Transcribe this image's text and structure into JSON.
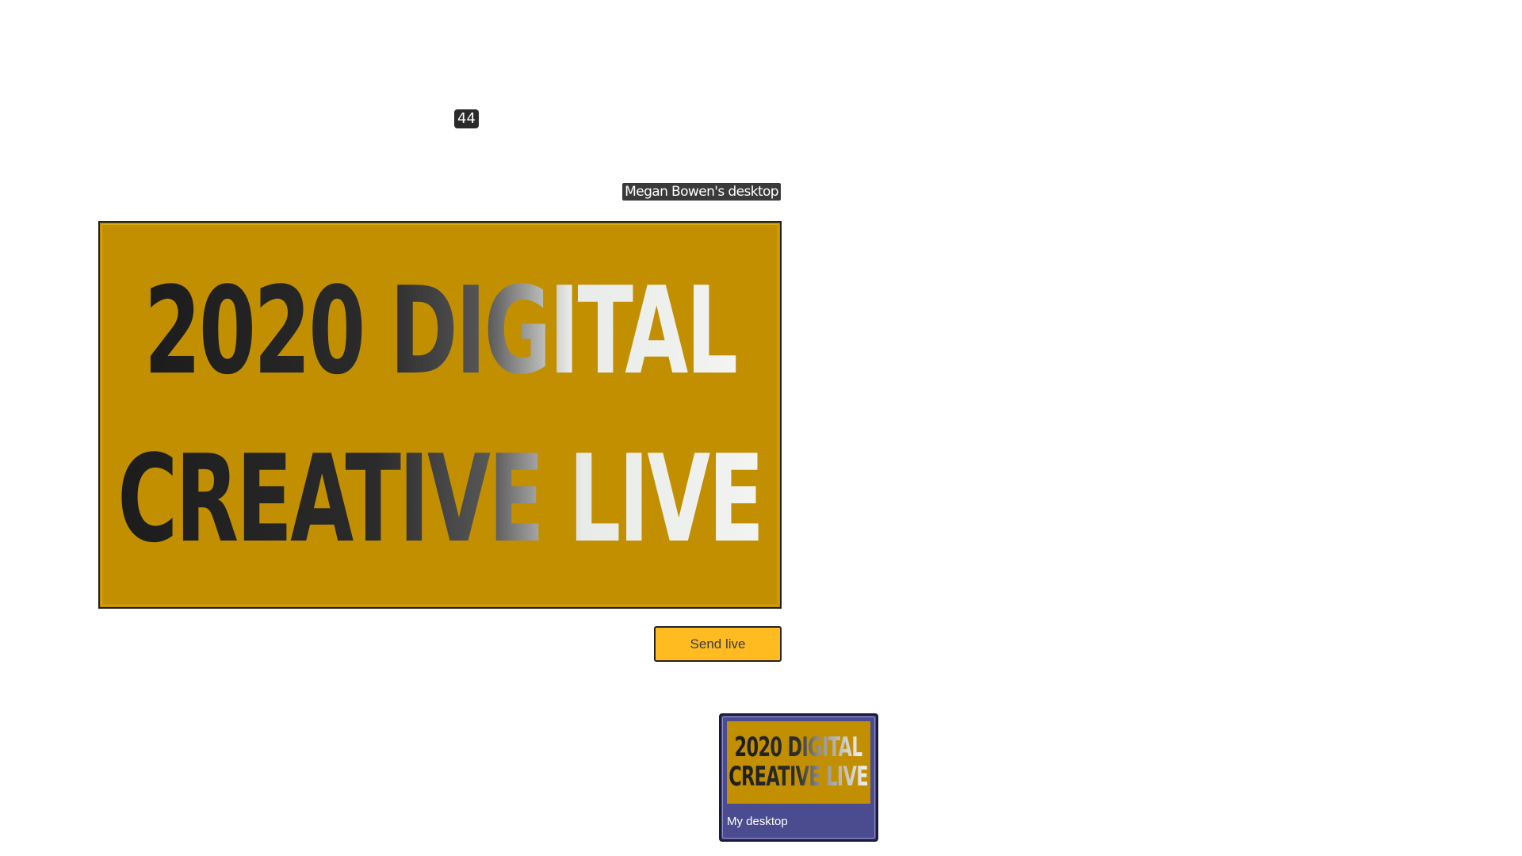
{
  "counter": {
    "value": "44"
  },
  "preview": {
    "label": "Megan Bowen's desktop",
    "content": {
      "line1": "2020 DIGITAL",
      "line2": "CREATIVE LIVE"
    },
    "background_color": "#c18f00"
  },
  "actions": {
    "send_live_label": "Send live",
    "accent_color": "#ffbb1f"
  },
  "sources": [
    {
      "label": "My desktop",
      "thumbnail": {
        "line1": "2020 DIGITAL",
        "line2": "CREATIVE LIVE"
      },
      "tile_color": "#4b4c8f"
    }
  ]
}
